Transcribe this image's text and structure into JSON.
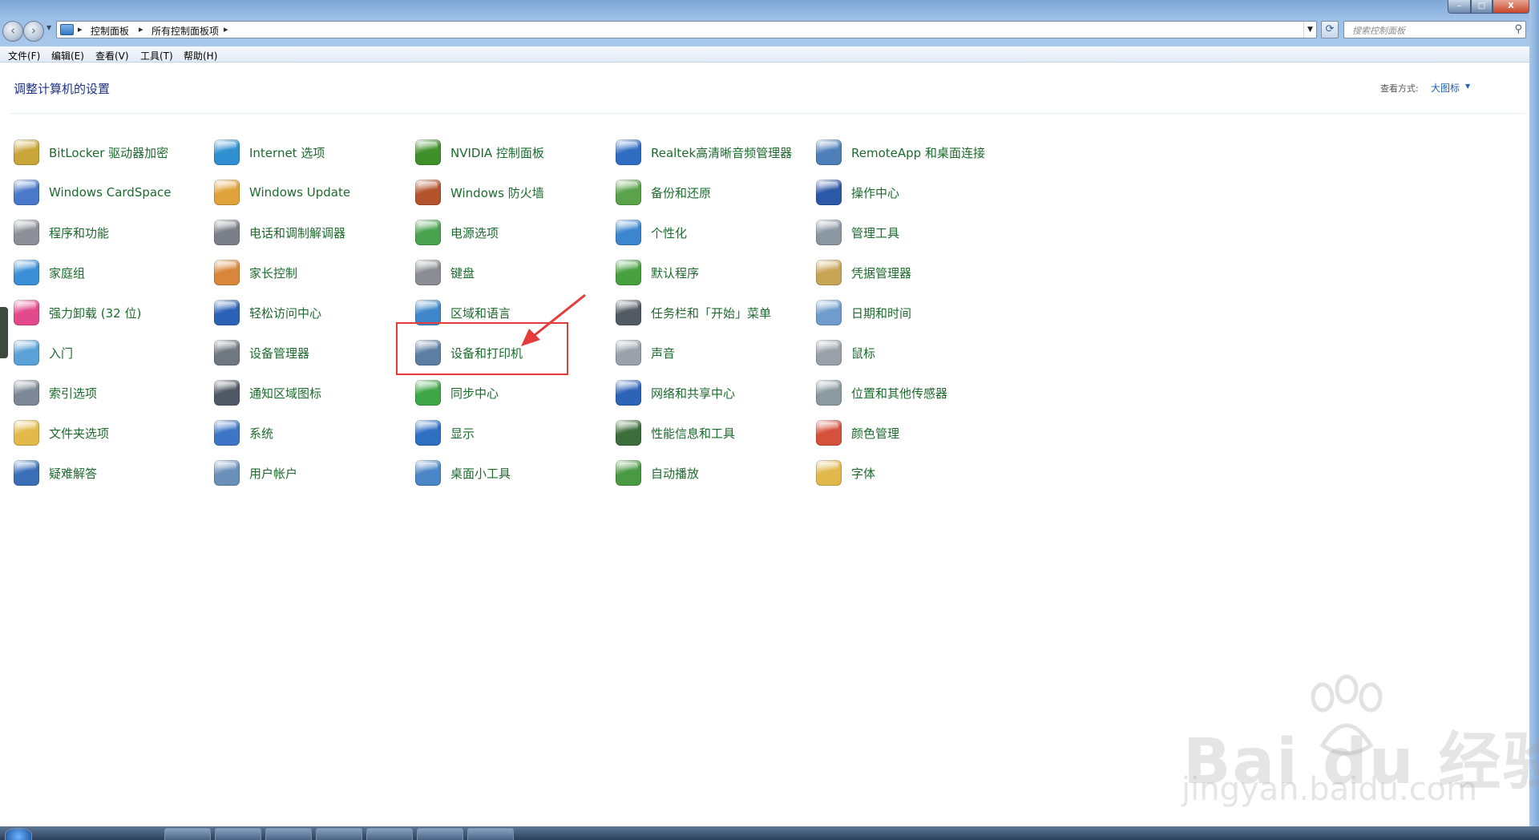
{
  "address_bar": {
    "crumbs": [
      "控制面板",
      "所有控制面板项"
    ],
    "search_placeholder": "搜索控制面板"
  },
  "window_controls": {
    "minimize": "–",
    "maximize": "□",
    "close": "X"
  },
  "menu": [
    {
      "label": "文件(F)"
    },
    {
      "label": "编辑(E)"
    },
    {
      "label": "查看(V)"
    },
    {
      "label": "工具(T)"
    },
    {
      "label": "帮助(H)"
    }
  ],
  "content": {
    "title": "调整计算机的设置",
    "view_by_label": "查看方式:",
    "view_by_value": "大图标"
  },
  "items": [
    {
      "label": "BitLocker 驱动器加密",
      "icon": "bitlocker-key-icon",
      "color": "#c9a53a"
    },
    {
      "label": "Windows CardSpace",
      "icon": "cardspace-icon",
      "color": "#4a79c9"
    },
    {
      "label": "程序和功能",
      "icon": "programs-icon",
      "color": "#8b8f97"
    },
    {
      "label": "家庭组",
      "icon": "homegroup-icon",
      "color": "#3b8fd6"
    },
    {
      "label": "强力卸载 (32 位)",
      "icon": "uninstaller-clover-icon",
      "color": "#e24a8b"
    },
    {
      "label": "入门",
      "icon": "getting-started-icon",
      "color": "#5aa1d8"
    },
    {
      "label": "索引选项",
      "icon": "indexing-magnifier-icon",
      "color": "#7d8896"
    },
    {
      "label": "文件夹选项",
      "icon": "folder-options-icon",
      "color": "#e3b949"
    },
    {
      "label": "疑难解答",
      "icon": "troubleshooting-icon",
      "color": "#3a6fb8"
    },
    {
      "label": "Internet 选项",
      "icon": "internet-options-icon",
      "color": "#2f8fd0"
    },
    {
      "label": "Windows Update",
      "icon": "windows-update-icon",
      "color": "#e0a23a"
    },
    {
      "label": "电话和调制解调器",
      "icon": "phone-modem-icon",
      "color": "#7a7f88"
    },
    {
      "label": "家长控制",
      "icon": "parental-controls-icon",
      "color": "#d9863b"
    },
    {
      "label": "轻松访问中心",
      "icon": "ease-of-access-icon",
      "color": "#2b62b5"
    },
    {
      "label": "设备管理器",
      "icon": "device-manager-icon",
      "color": "#6f7780"
    },
    {
      "label": "通知区域图标",
      "icon": "notification-area-icon",
      "color": "#4f5864"
    },
    {
      "label": "系统",
      "icon": "system-icon",
      "color": "#3d76c6"
    },
    {
      "label": "用户帐户",
      "icon": "user-accounts-icon",
      "color": "#6a8fb8"
    },
    {
      "label": "NVIDIA 控制面板",
      "icon": "nvidia-icon",
      "color": "#3f8f2a"
    },
    {
      "label": "Windows 防火墙",
      "icon": "firewall-icon",
      "color": "#b3542d"
    },
    {
      "label": "电源选项",
      "icon": "power-options-icon",
      "color": "#4aa24f"
    },
    {
      "label": "键盘",
      "icon": "keyboard-icon",
      "color": "#8a8d92"
    },
    {
      "label": "区域和语言",
      "icon": "region-language-icon",
      "color": "#3e86c9"
    },
    {
      "label": "设备和打印机",
      "icon": "printer-icon",
      "color": "#5d7ea3"
    },
    {
      "label": "同步中心",
      "icon": "sync-center-icon",
      "color": "#3ea646"
    },
    {
      "label": "显示",
      "icon": "display-icon",
      "color": "#2f6fc2"
    },
    {
      "label": "桌面小工具",
      "icon": "gadgets-icon",
      "color": "#4b86c6"
    },
    {
      "label": "Realtek高清晰音频管理器",
      "icon": "realtek-audio-icon",
      "color": "#2f6dc2"
    },
    {
      "label": "备份和还原",
      "icon": "backup-restore-icon",
      "color": "#5aa34b"
    },
    {
      "label": "个性化",
      "icon": "personalization-icon",
      "color": "#3c86cf"
    },
    {
      "label": "默认程序",
      "icon": "default-programs-icon",
      "color": "#47a13e"
    },
    {
      "label": "任务栏和「开始」菜单",
      "icon": "taskbar-start-icon",
      "color": "#525a63"
    },
    {
      "label": "声音",
      "icon": "sound-icon",
      "color": "#9aa1aa"
    },
    {
      "label": "网络和共享中心",
      "icon": "network-sharing-icon",
      "color": "#2e64b8"
    },
    {
      "label": "性能信息和工具",
      "icon": "performance-icon",
      "color": "#3b6e3a"
    },
    {
      "label": "自动播放",
      "icon": "autoplay-icon",
      "color": "#4a9a44"
    },
    {
      "label": "RemoteApp 和桌面连接",
      "icon": "remoteapp-icon",
      "color": "#4f7fb9"
    },
    {
      "label": "操作中心",
      "icon": "action-center-flag-icon",
      "color": "#2c58a8"
    },
    {
      "label": "管理工具",
      "icon": "admin-tools-icon",
      "color": "#8b96a3"
    },
    {
      "label": "凭据管理器",
      "icon": "credential-manager-icon",
      "color": "#c8a455"
    },
    {
      "label": "日期和时间",
      "icon": "date-time-icon",
      "color": "#6f9ccc"
    },
    {
      "label": "鼠标",
      "icon": "mouse-icon",
      "color": "#9aa0a8"
    },
    {
      "label": "位置和其他传感器",
      "icon": "location-sensors-icon",
      "color": "#8a9aa0"
    },
    {
      "label": "颜色管理",
      "icon": "color-management-icon",
      "color": "#d6513b"
    },
    {
      "label": "字体",
      "icon": "fonts-icon",
      "color": "#e0b84c"
    }
  ],
  "watermark": {
    "brand": "Bai du 经验",
    "url": "jingyan.baidu.com"
  }
}
